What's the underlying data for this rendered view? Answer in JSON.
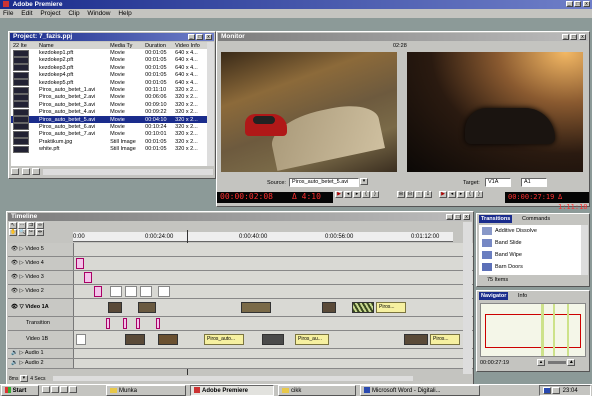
{
  "app": {
    "title": "Adobe Premiere"
  },
  "menubar": [
    "File",
    "Edit",
    "Project",
    "Clip",
    "Window",
    "Help"
  ],
  "project": {
    "title": "Project: 7_fazis.ppj",
    "item_count": "22 Ite",
    "columns": [
      "Name",
      "Media Ty",
      "Duration",
      "Video Info"
    ],
    "rows": [
      {
        "name": "kezdokep1.pft",
        "type": "Movie",
        "dur": "00:01:05",
        "info": "640 x 4..."
      },
      {
        "name": "kezdokep2.pft",
        "type": "Movie",
        "dur": "00:01:05",
        "info": "640 x 4..."
      },
      {
        "name": "kezdokep3.pft",
        "type": "Movie",
        "dur": "00:01:05",
        "info": "640 x 4..."
      },
      {
        "name": "kezdokep4.pft",
        "type": "Movie",
        "dur": "00:01:05",
        "info": "640 x 4..."
      },
      {
        "name": "kezdokep5.pft",
        "type": "Movie",
        "dur": "00:01:05",
        "info": "640 x 4..."
      },
      {
        "name": "Piros_auto_betet_1.avi",
        "type": "Movie",
        "dur": "00:11:10",
        "info": "320 x 2..."
      },
      {
        "name": "Piros_auto_betet_2.avi",
        "type": "Movie",
        "dur": "00:06:06",
        "info": "320 x 2..."
      },
      {
        "name": "Piros_auto_betet_3.avi",
        "type": "Movie",
        "dur": "00:09:10",
        "info": "320 x 2..."
      },
      {
        "name": "Piros_auto_betet_4.avi",
        "type": "Movie",
        "dur": "00:09:22",
        "info": "320 x 2..."
      },
      {
        "name": "Piros_auto_betet_5.avi",
        "type": "Movie",
        "dur": "00:04:10",
        "info": "320 x 2..."
      },
      {
        "name": "Piros_auto_betet_6.avi",
        "type": "Movie",
        "dur": "00:10:24",
        "info": "320 x 2..."
      },
      {
        "name": "Piros_auto_betet_7.avi",
        "type": "Movie",
        "dur": "00:10:01",
        "info": "320 x 2..."
      },
      {
        "name": "Praktikum.jpg",
        "type": "Still Image",
        "dur": "00:01:05",
        "info": "320 x 2..."
      },
      {
        "name": "white.pft",
        "type": "Still Image",
        "dur": "00:01:05",
        "info": "320 x 2..."
      }
    ],
    "selected_index": 9
  },
  "monitor": {
    "title": "Monitor",
    "program_label": "02:28",
    "source_label": "Source:",
    "source_value": "Piros_auto_betet_5.avi",
    "target_label": "Target:",
    "target_value": "V1A",
    "target_value2": "A1",
    "source_tc": "00:00:02:08",
    "source_dur": "Δ 4:10",
    "program_tc": "00:00:27:19",
    "program_dur": "Δ 1:11:10"
  },
  "timeline": {
    "title": "Timeline",
    "ruler": [
      "0:00",
      "0:00:24:00",
      "0:00:40:00",
      "0:00:56:00",
      "0:01:12:00"
    ],
    "tracks": [
      "Video 5",
      "Video 4",
      "Video 3",
      "Video 2",
      "Video 1A",
      "Transition",
      "Video 1B",
      "Audio 1",
      "Audio 2"
    ],
    "clip_labels": {
      "v1a_a": "Piros...",
      "v1b_a": "Piros_auto...",
      "v1b_b": "Piros_au...",
      "v1b_c": "Piros..."
    },
    "footer": "4 Secs",
    "footer_left": "8ms"
  },
  "transitions": {
    "tab1": "Transitions",
    "tab2": "Commands",
    "items": [
      "Additive Dissolve",
      "Band Slide",
      "Band Wipe",
      "Barn Doors"
    ],
    "count": "75 Items"
  },
  "navigator": {
    "tab1": "Navigator",
    "tab2": "Info",
    "timecode": "00:00:27:19"
  },
  "taskbar": {
    "start": "Start",
    "tasks": [
      "Munka",
      "Adobe Premiere",
      "cikk",
      "Microsoft Word - Digitali..."
    ],
    "clock": "23:04"
  },
  "colors": {
    "titlebar": "#1a2c8c",
    "desktop": "#6f8f84",
    "clip_yellow": "#f6f0a0",
    "clip_pink": "#f3c4ea",
    "lcd_text": "#ff3030"
  }
}
